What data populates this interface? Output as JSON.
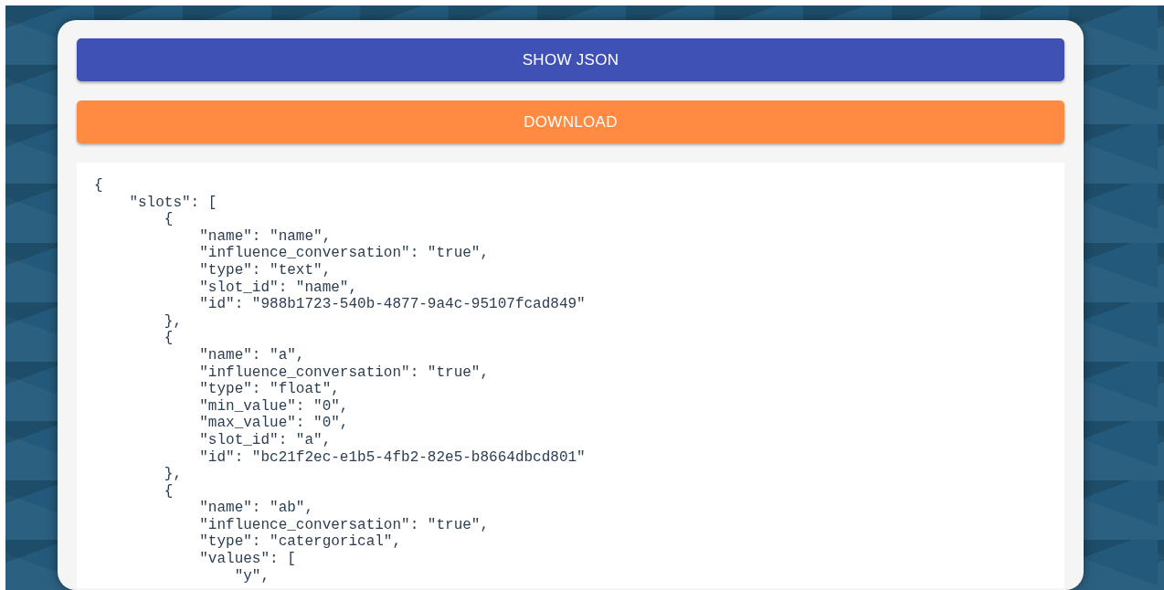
{
  "buttons": [
    {
      "label": "SHOW JSON",
      "kind": "primary"
    },
    {
      "label": "DOWNLOAD",
      "kind": "accent"
    }
  ],
  "json_view": {
    "text": "{\n    \"slots\": [\n        {\n            \"name\": \"name\",\n            \"influence_conversation\": \"true\",\n            \"type\": \"text\",\n            \"slot_id\": \"name\",\n            \"id\": \"988b1723-540b-4877-9a4c-95107fcad849\"\n        },\n        {\n            \"name\": \"a\",\n            \"influence_conversation\": \"true\",\n            \"type\": \"float\",\n            \"min_value\": \"0\",\n            \"max_value\": \"0\",\n            \"slot_id\": \"a\",\n            \"id\": \"bc21f2ec-e1b5-4fb2-82e5-b8664dbcd801\"\n        },\n        {\n            \"name\": \"ab\",\n            \"influence_conversation\": \"true\",\n            \"type\": \"catergorical\",\n            \"values\": [\n                \"y\","
  }
}
